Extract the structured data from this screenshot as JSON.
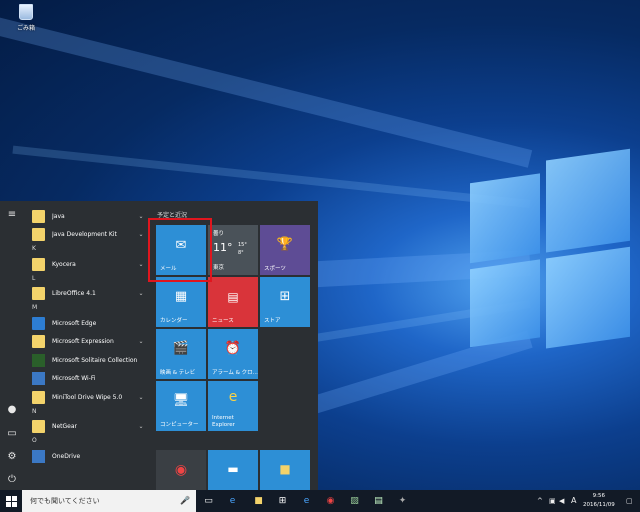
{
  "desktop": {
    "recycle_bin_label": "ごみ箱"
  },
  "start_menu": {
    "apps": [
      {
        "type": "item",
        "label": "Java",
        "icon": "folder",
        "expandable": true
      },
      {
        "type": "item",
        "label": "Java Development Kit",
        "icon": "folder",
        "expandable": true
      },
      {
        "type": "header",
        "label": "K"
      },
      {
        "type": "item",
        "label": "Kyocera",
        "icon": "folder",
        "expandable": true
      },
      {
        "type": "header",
        "label": "L"
      },
      {
        "type": "item",
        "label": "LibreOffice 4.1",
        "icon": "folder",
        "expandable": true
      },
      {
        "type": "header",
        "label": "M"
      },
      {
        "type": "item",
        "label": "Microsoft Edge",
        "icon": "edge",
        "expandable": false
      },
      {
        "type": "item",
        "label": "Microsoft Expression",
        "icon": "folder",
        "expandable": true
      },
      {
        "type": "item",
        "label": "Microsoft Solitaire Collection",
        "icon": "cards",
        "expandable": false
      },
      {
        "type": "item",
        "label": "Microsoft Wi-Fi",
        "icon": "blue",
        "expandable": false
      },
      {
        "type": "item",
        "label": "MiniTool Drive Wipe 5.0",
        "icon": "folder",
        "expandable": true
      },
      {
        "type": "header",
        "label": "N"
      },
      {
        "type": "item",
        "label": "NetGear",
        "icon": "folder",
        "expandable": true
      },
      {
        "type": "header",
        "label": "O"
      },
      {
        "type": "item",
        "label": "OneDrive",
        "icon": "blue",
        "expandable": false
      }
    ],
    "tile_group_title": "予定と近況",
    "tiles": {
      "mail": "メール",
      "weather": {
        "condition": "曇り",
        "temp": "11°",
        "high": "15°",
        "low": "8°",
        "city": "東京"
      },
      "sports": "スポーツ",
      "calendar": "カレンダー",
      "news": "ニュース",
      "store": "ストア",
      "movies": "映画 & テレビ",
      "alarm": "アラーム & クロ...",
      "computer": "コンピューター",
      "ie_line1": "Internet",
      "ie_line2": "Explorer"
    }
  },
  "taskbar": {
    "search_placeholder": "何でも聞いてください",
    "ime": "A",
    "time": "9:56",
    "date": "2016/11/09"
  }
}
